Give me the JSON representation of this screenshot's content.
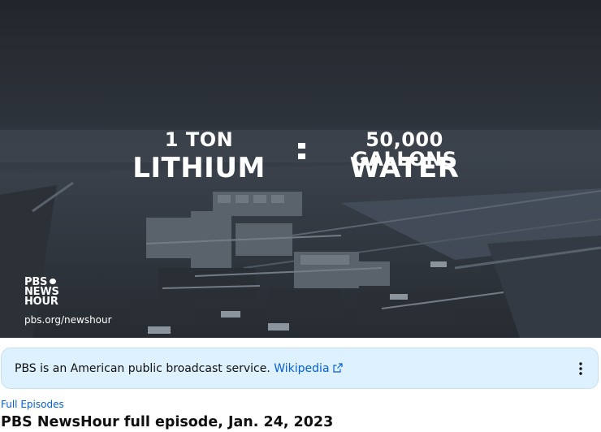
{
  "video": {
    "overlay": {
      "left_top": "1 TON",
      "left_bottom": "LITHIUM",
      "right_top": "50,000 GALLONS",
      "right_bottom": "WATER"
    },
    "brand": {
      "line1": "PBS",
      "line2": "NEWS",
      "line3": "HOUR",
      "url": "pbs.org/newshour"
    }
  },
  "info_panel": {
    "text": "PBS is an American public broadcast service.",
    "link_label": "Wikipedia",
    "link_icon": "external-link-icon",
    "more_icon": "more-vert-icon"
  },
  "category_label": "Full Episodes",
  "title": "PBS NewsHour full episode, Jan. 24, 2023",
  "colors": {
    "panel_bg": "#def1fe",
    "link": "#065fd4",
    "text": "#0f0f0f"
  }
}
